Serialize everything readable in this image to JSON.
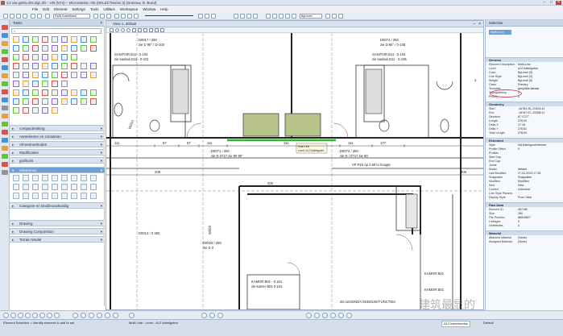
{
  "window": {
    "title": "C2 uiw ge0a.dmr.dgn.2D - V8i (NT4) – MicroStation V8i (SELECTseries 3) (Sneeuw, B. Bond)"
  },
  "menu": [
    "File",
    "Edit",
    "Element",
    "Settings",
    "Tools",
    "Utilities",
    "Workspace",
    "Window",
    "Help"
  ],
  "toolbar": {
    "level_label": "RUB Kabeltracé",
    "color_label": "ByLevel"
  },
  "tool_panel": {
    "title": "Tasks",
    "search_placeholder": "",
    "sections": [
      {
        "label": "compact/editing",
        "selected": false
      },
      {
        "label": "Aantekenen en schaalvan",
        "selected": false
      },
      {
        "label": "Afmeetmethoden",
        "selected": false
      },
      {
        "label": "Modificaties",
        "selected": false
      },
      {
        "label": "graftools",
        "selected": false
      },
      {
        "label": "references",
        "selected": true
      },
      {
        "label": "Categorie en landbrouwkundig",
        "selected": false
      },
      {
        "label": "Drawing",
        "selected": false
      },
      {
        "label": "Drawing Composition",
        "selected": false
      },
      {
        "label": "Terrain Model",
        "selected": false
      }
    ]
  },
  "view": {
    "tab_label": "View 1, default",
    "drawing_labels": {
      "door1": "D0017 / 250",
      "door1b": "zie D 90° / D-100",
      "door2": "D0074 / 250",
      "door2b": "zie D 90° / 0-105",
      "room1": "SANITAIR B11 - 0.102",
      "room1b": "zie sanitair B11 - 0-101",
      "room2": "SANITAIR B11 - 0.102",
      "room2b": "zie sanitair B11 - 0-105",
      "door3": "D0071 / 250",
      "door3b": "zie D 0717 zie 90 90°",
      "door4": "D0073 / 250",
      "door4b": "zie D / 0717 zie 90",
      "tooltip": "Multi Line",
      "tooltip2": "Level: A12 kabelgoten",
      "dim1": "208",
      "dim2": "200",
      "dim3": "230",
      "dim4": "220",
      "dim5": "111",
      "dim6": "57",
      "dim7": "177",
      "dim8": "209",
      "dim9": "208",
      "vp": "VP P15 op 2.60 m hoogte",
      "door5": "D0013 / 0 250",
      "door6": "D0034 / 250",
      "door6b": "zie D 0",
      "room3": "KAMOR B01 - 0.101",
      "room3b": "zie kamer B01 0-101",
      "room4": "KAMOR B01",
      "room5": "KAMOR B01",
      "annot": "Zie LEGENDA GEBOUW FUNCTIES",
      "v1": "V0014",
      "w1": "W003",
      "lbl_4": "4"
    }
  },
  "properties": {
    "title": "Selection",
    "element_type": "Multi-Line",
    "sections": [
      {
        "label": "General",
        "rows": [
          {
            "k": "Element Description",
            "v": "Multi-Line"
          },
          {
            "k": "Level",
            "v": "A12 kabelgoten"
          },
          {
            "k": "Color",
            "v": "ByLevel (0)"
          },
          {
            "k": "Line Style",
            "v": "ByLevel (0)"
          },
          {
            "k": "Weight",
            "v": "ByLevel (0)"
          },
          {
            "k": "Class",
            "v": "Primary"
          },
          {
            "k": "Template",
            "v": "gesprikte kanaal"
          },
          {
            "k": "Transparency",
            "v": "0"
          },
          {
            "k": "Priority",
            "v": "0"
          }
        ]
      },
      {
        "label": "Geometry",
        "rows": [
          {
            "k": "Start",
            "v": "-16769.35,-22403.41"
          },
          {
            "k": "End",
            "v": "-16767.07,-22398.11"
          },
          {
            "k": "Direction",
            "v": "67.1727°"
          },
          {
            "k": "Length",
            "v": "278.00"
          },
          {
            "k": "Delta X",
            "v": "27.18"
          },
          {
            "k": "Delta Y",
            "v": "276.61"
          },
          {
            "k": "Total Length",
            "v": "278.00"
          }
        ]
      },
      {
        "label": "Extended",
        "rows": [
          {
            "k": "Style",
            "v": "NA Kabelgoot/Internet"
          },
          {
            "k": "Profile Offset",
            "v": "0"
          },
          {
            "k": "Profiles",
            "v": ""
          },
          {
            "k": "Start Cap",
            "v": ""
          },
          {
            "k": "End Cap",
            "v": ""
          },
          {
            "k": "Joints",
            "v": ""
          },
          {
            "k": "Model",
            "v": "default"
          },
          {
            "k": "Last Modified",
            "v": "27-02-2013 17:35"
          },
          {
            "k": "Snappable",
            "v": "Snappable"
          },
          {
            "k": "Modified",
            "v": "Modified"
          },
          {
            "k": "New",
            "v": "New"
          },
          {
            "k": "Locked",
            "v": "Unlocked"
          },
          {
            "k": "Line Style Params",
            "v": ""
          },
          {
            "k": "Display Style",
            "v": "From View"
          }
        ]
      },
      {
        "label": "Raw Data",
        "rows": [
          {
            "k": "Element ID",
            "v": "287180"
          },
          {
            "k": "Size",
            "v": "280"
          },
          {
            "k": "File Position",
            "v": "86519827"
          },
          {
            "k": "Linkages",
            "v": "0"
          },
          {
            "k": "XAttributes",
            "v": "0"
          }
        ]
      },
      {
        "label": "Material",
        "rows": [
          {
            "k": "Attached Material",
            "v": "(None)"
          },
          {
            "k": "Assigned Material",
            "v": "(None)"
          }
        ]
      }
    ]
  },
  "status": {
    "left": "Element Selection > Identify element to add to set",
    "middle": "Multi Line : Level : A12 kabelgoten",
    "right_model": "A12 kabelmodus",
    "right_coord": "Default"
  },
  "watermark": "建筑最显的",
  "colors": {
    "accent": "#6f9fd8",
    "panel": "#d8e3ef",
    "highlight_green": "#2db52d",
    "room_fill": "#b9c48a",
    "red_ellipse": "#d94060"
  }
}
